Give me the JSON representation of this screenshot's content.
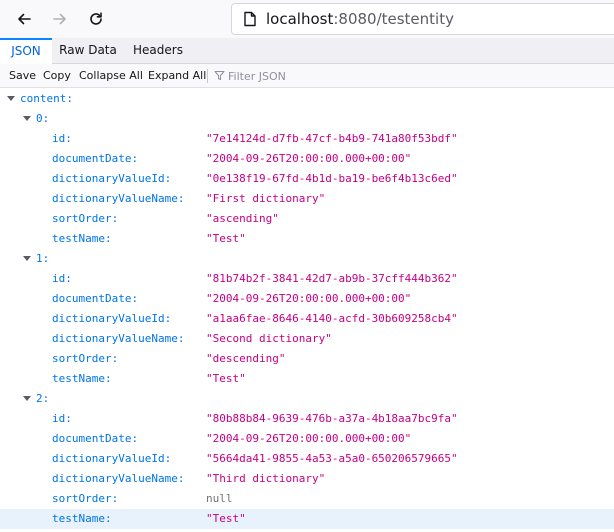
{
  "browser": {
    "url_host": "localhost",
    "url_rest": ":8080/testentity"
  },
  "tabs": [
    {
      "label": "JSON",
      "active": true
    },
    {
      "label": "Raw Data",
      "active": false
    },
    {
      "label": "Headers",
      "active": false
    }
  ],
  "toolbar": {
    "save": "Save",
    "copy": "Copy",
    "collapse_all": "Collapse All",
    "expand_all": "Expand All",
    "filter_placeholder": "Filter JSON"
  },
  "colors": {
    "key": "#0074e8",
    "string": "#c50084",
    "null": "#737373",
    "active_tab": "#0060df",
    "row_highlight": "#e8f2fd"
  },
  "json": {
    "root_key": "content:",
    "items": [
      {
        "index": "0:",
        "fields": [
          {
            "key": "id:",
            "value": "\"7e14124d-d7fb-47cf-b4b9-741a80f53bdf\"",
            "type": "string"
          },
          {
            "key": "documentDate:",
            "value": "\"2004-09-26T20:00:00.000+00:00\"",
            "type": "string"
          },
          {
            "key": "dictionaryValueId:",
            "value": "\"0e138f19-67fd-4b1d-ba19-be6f4b13c6ed\"",
            "type": "string"
          },
          {
            "key": "dictionaryValueName:",
            "value": "\"First dictionary\"",
            "type": "string"
          },
          {
            "key": "sortOrder:",
            "value": "\"ascending\"",
            "type": "string"
          },
          {
            "key": "testName:",
            "value": "\"Test\"",
            "type": "string"
          }
        ]
      },
      {
        "index": "1:",
        "fields": [
          {
            "key": "id:",
            "value": "\"81b74b2f-3841-42d7-ab9b-37cff444b362\"",
            "type": "string"
          },
          {
            "key": "documentDate:",
            "value": "\"2004-09-26T20:00:00.000+00:00\"",
            "type": "string"
          },
          {
            "key": "dictionaryValueId:",
            "value": "\"a1aa6fae-8646-4140-acfd-30b609258cb4\"",
            "type": "string"
          },
          {
            "key": "dictionaryValueName:",
            "value": "\"Second dictionary\"",
            "type": "string"
          },
          {
            "key": "sortOrder:",
            "value": "\"descending\"",
            "type": "string"
          },
          {
            "key": "testName:",
            "value": "\"Test\"",
            "type": "string"
          }
        ]
      },
      {
        "index": "2:",
        "fields": [
          {
            "key": "id:",
            "value": "\"80b88b84-9639-476b-a37a-4b18aa7bc9fa\"",
            "type": "string"
          },
          {
            "key": "documentDate:",
            "value": "\"2004-09-26T20:00:00.000+00:00\"",
            "type": "string"
          },
          {
            "key": "dictionaryValueId:",
            "value": "\"5664da41-9855-4a53-a5a0-650206579665\"",
            "type": "string"
          },
          {
            "key": "dictionaryValueName:",
            "value": "\"Third dictionary\"",
            "type": "string"
          },
          {
            "key": "sortOrder:",
            "value": "null",
            "type": "null"
          },
          {
            "key": "testName:",
            "value": "\"Test\"",
            "type": "string",
            "highlighted": true
          }
        ]
      }
    ]
  }
}
